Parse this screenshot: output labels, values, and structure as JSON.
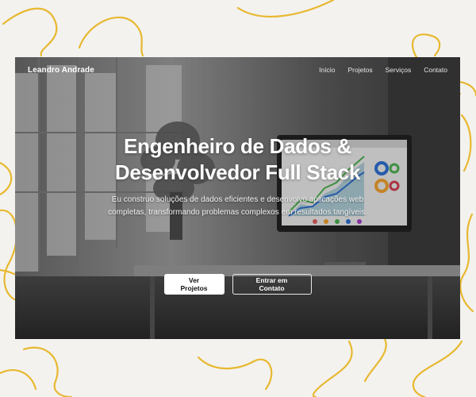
{
  "nav": {
    "brand": "Leandro Andrade",
    "items": [
      {
        "label": "Início"
      },
      {
        "label": "Projetos"
      },
      {
        "label": "Serviços"
      },
      {
        "label": "Contato"
      }
    ]
  },
  "hero": {
    "title": "Engenheiro de Dados & Desenvolvedor Full Stack",
    "subtitle": "Eu construo soluções de dados eficientes e desenvolvo aplicações web completas, transformando problemas complexos em resultados tangíveis.",
    "primary_button": "Ver Projetos",
    "secondary_button": "Entrar em Contato"
  },
  "colors": {
    "page_background": "#f3f2ef",
    "decor_line": "#e8b830",
    "primary_button_bg": "#ffffff",
    "chart_green": "#4caf50",
    "chart_blue": "#2f6fd0"
  }
}
